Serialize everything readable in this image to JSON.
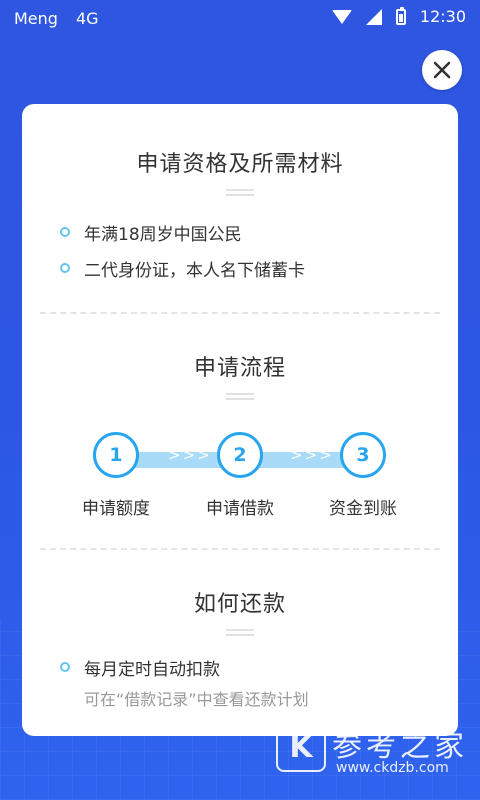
{
  "status_bar": {
    "carrier": "Meng",
    "network": "4G",
    "time": "12:30",
    "icons": [
      "wifi-icon",
      "signal-icon",
      "battery-icon"
    ]
  },
  "close_button": {
    "icon": "close-icon"
  },
  "section1": {
    "title": "申请资格及所需材料",
    "items": [
      "年满18周岁中国公民",
      "二代身份证，本人名下储蓄卡"
    ]
  },
  "section2": {
    "title": "申请流程",
    "steps": [
      {
        "number": "1",
        "label": "申请额度"
      },
      {
        "number": "2",
        "label": "申请借款"
      },
      {
        "number": "3",
        "label": "资金到账"
      }
    ],
    "arrow_text": ">>>"
  },
  "section3": {
    "title": "如何还款",
    "items": [
      "每月定时自动扣款"
    ],
    "subtext": "可在“借款记录”中查看还款计划"
  },
  "watermark": {
    "logo": "K",
    "text": "参考之家",
    "url": "www.ckdzb.com"
  },
  "colors": {
    "background": "#2f56e0",
    "accent": "#27a5ef",
    "track": "#a7dbf8"
  }
}
